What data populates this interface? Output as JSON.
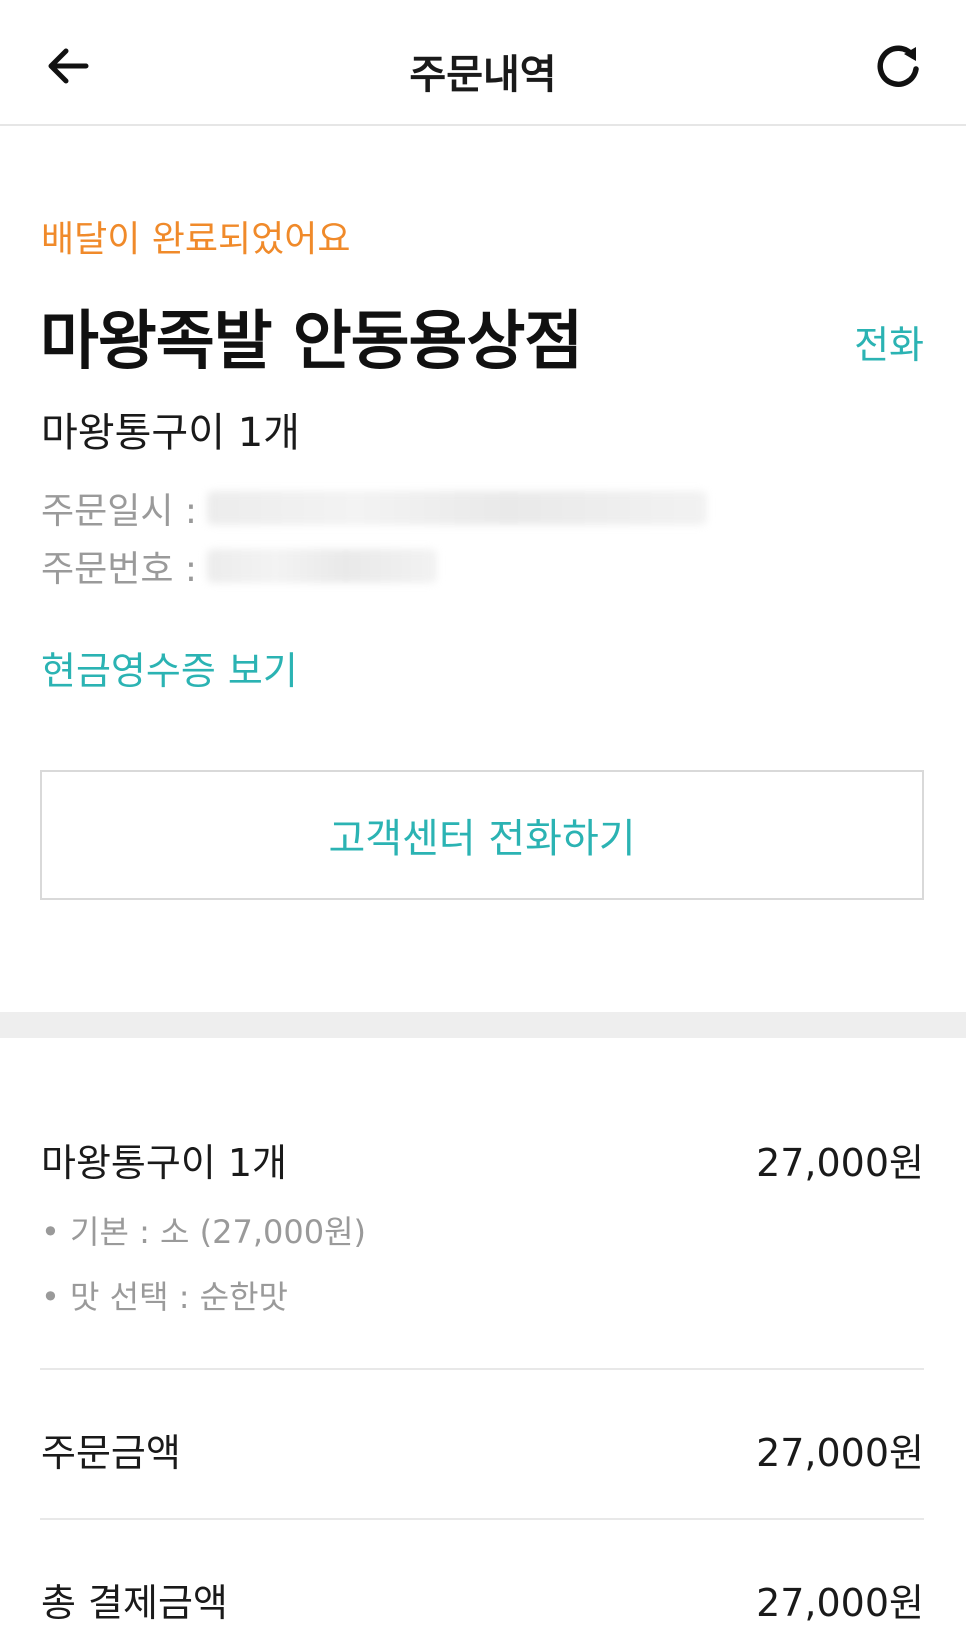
{
  "header": {
    "title": "주문내역"
  },
  "order": {
    "status": "배달이 완료되었어요",
    "store_name": "마왕족발 안동용상점",
    "call_label": "전화",
    "item_summary": "마왕통구이 1개",
    "order_datetime_label": "주문일시 :",
    "order_number_label": "주문번호 :",
    "receipt_label": "현금영수증 보기",
    "cs_button_label": "고객센터 전화하기"
  },
  "items": [
    {
      "name": "마왕통구이 1개",
      "price": "27,000원",
      "options": [
        "• 기본 : 소 (27,000원)",
        "• 맛 선택 : 순한맛"
      ]
    }
  ],
  "summary": {
    "order_amount_label": "주문금액",
    "order_amount": "27,000원",
    "total_label": "총 결제금액",
    "total_amount": "27,000원"
  },
  "colors": {
    "accent_teal": "#2bb3b3",
    "status_orange": "#f08a2a"
  },
  "icons": {
    "back": "arrow-left-icon",
    "refresh": "refresh-icon"
  }
}
